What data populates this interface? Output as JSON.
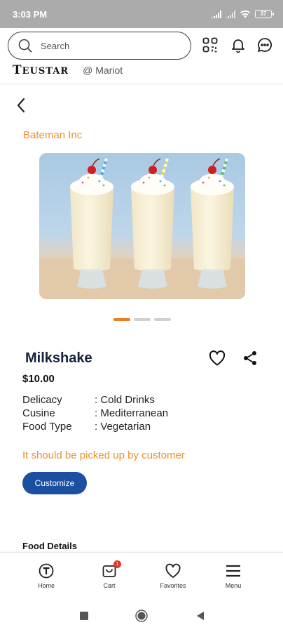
{
  "status_bar": {
    "time": "3:03 PM",
    "battery": "37"
  },
  "header": {
    "search": {
      "placeholder": "Search"
    },
    "brand": {
      "logo_initial": "T",
      "logo_rest": "EUSTAR",
      "store": "@ Mariot"
    }
  },
  "product": {
    "vendor": "Bateman Inc",
    "name": "Milkshake",
    "price": "$10.00",
    "attributes": [
      {
        "label": "Delicacy",
        "value": ": Cold Drinks"
      },
      {
        "label": "Cusine",
        "value": ": Mediterranean"
      },
      {
        "label": "Food Type",
        "value": ": Vegetarian"
      }
    ],
    "pickup_note": "It should be picked up by customer",
    "customize_label": "Customize",
    "details_heading": "Food Details",
    "carousel": {
      "count": 3,
      "active_index": 0
    }
  },
  "bottom_nav": {
    "items": [
      {
        "label": "Home",
        "icon": "home-logo-icon"
      },
      {
        "label": "Cart",
        "icon": "cart-icon",
        "badge": "1"
      },
      {
        "label": "Favorites",
        "icon": "heart-icon"
      },
      {
        "label": "Menu",
        "icon": "menu-icon"
      }
    ]
  },
  "colors": {
    "accent_orange": "#e8912e",
    "primary_blue": "#1b4fa0",
    "title_navy": "#16213e",
    "badge_red": "#e0392b"
  }
}
